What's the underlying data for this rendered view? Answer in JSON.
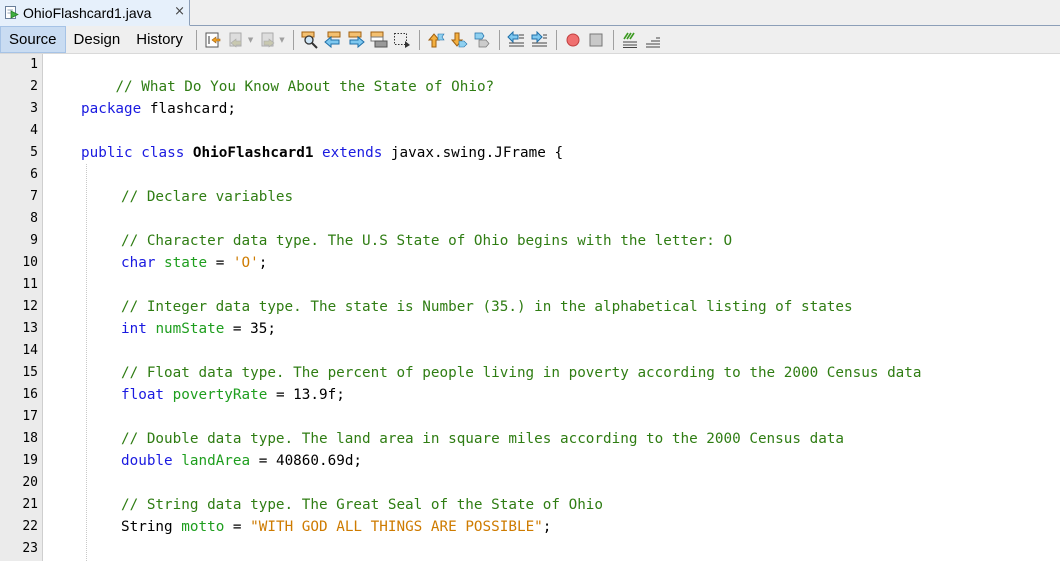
{
  "file_tab": {
    "name": "OhioFlashcard1.java",
    "close_glyph": "×",
    "icon": "java-file-icon"
  },
  "view_tabs": [
    {
      "label": "Source",
      "active": true
    },
    {
      "label": "Design",
      "active": false
    },
    {
      "label": "History",
      "active": false
    }
  ],
  "toolbar_icons": [
    "last-edit-icon",
    "back-icon",
    "forward-icon",
    "find-selection-icon",
    "find-previous-icon",
    "find-next-icon",
    "toggle-highlight-icon",
    "toggle-rectangular-selection-icon",
    "previous-bookmark-icon",
    "next-bookmark-icon",
    "toggle-bookmark-icon",
    "shift-left-icon",
    "shift-right-icon",
    "start-macro-recording-icon",
    "stop-macro-recording-icon",
    "comment-icon",
    "uncomment-icon"
  ],
  "colors": {
    "comment": "#2f7d13",
    "keyword": "#1a1ae0",
    "field": "#1e9e1e",
    "string": "#ce7b00",
    "active_tab": "#c9dcf2"
  },
  "code": {
    "line_numbers": [
      "1",
      "2",
      "3",
      "4",
      "5",
      "6",
      "7",
      "8",
      "9",
      "10",
      "11",
      "12",
      "13",
      "14",
      "15",
      "16",
      "17",
      "18",
      "19",
      "20",
      "21",
      "22",
      "23"
    ],
    "l1": "// What Do You Know About the State of Ohio?",
    "l3_kw": "package",
    "l3_rest": " flashcard;",
    "l5_kw1": "public",
    "l5_kw2": "class",
    "l5_name": "OhioFlashcard1",
    "l5_kw3": "extends",
    "l5_rest": " javax.swing.JFrame {",
    "l7": "// Declare variables",
    "l9": "// Character data type. The U.S State of Ohio begins with the letter: O",
    "l10_kw": "char",
    "l10_var": "state",
    "l10_eq": " = ",
    "l10_val": "'O'",
    "l10_end": ";",
    "l12": "// Integer data type. The state is Number (35.) in the alphabetical listing of states",
    "l13_kw": "int",
    "l13_var": "numState",
    "l13_rest": " = 35;",
    "l15": "// Float data type. The percent of people living in poverty according to the 2000 Census data",
    "l16_kw": "float",
    "l16_var": "povertyRate",
    "l16_rest": " = 13.9f;",
    "l18": "// Double data type. The land area in square miles according to the 2000 Census data",
    "l19_kw": "double",
    "l19_var": "landArea",
    "l19_rest": " = 40860.69d;",
    "l21": "// String data type. The Great Seal of the State of Ohio",
    "l22_type": "String",
    "l22_var": "motto",
    "l22_eq": " = ",
    "l22_val": "\"WITH GOD ALL THINGS ARE POSSIBLE\"",
    "l22_end": ";"
  }
}
